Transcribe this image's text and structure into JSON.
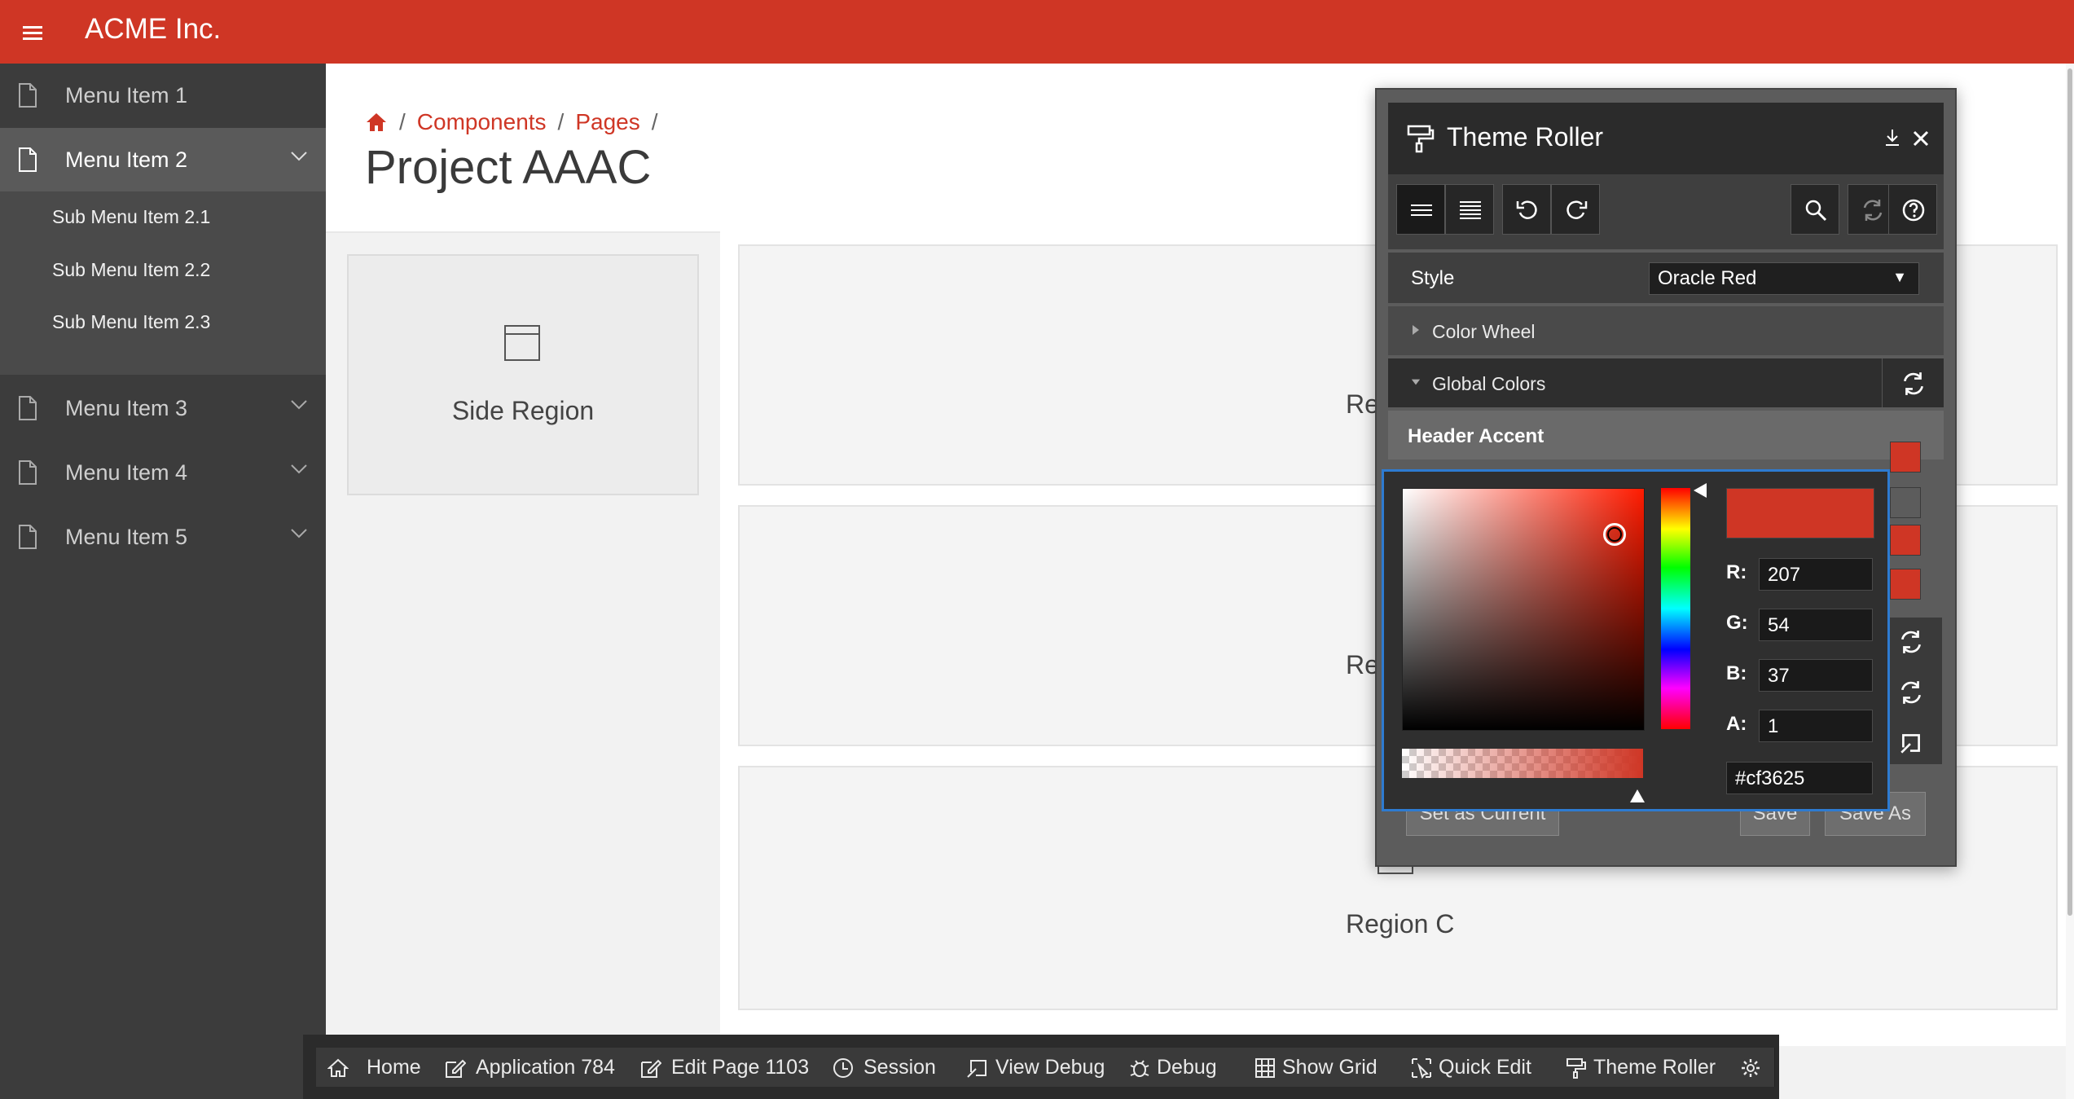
{
  "app": {
    "brand": "ACME Inc."
  },
  "colors": {
    "accent": "#cf3625",
    "sidebar": "#3c3c3c",
    "panel": "#2b2b2b"
  },
  "sidebar": {
    "items": [
      {
        "label": "Menu Item 1",
        "icon": "page-icon",
        "expanded": false,
        "has_children": false
      },
      {
        "label": "Menu Item 2",
        "icon": "page-icon",
        "expanded": true,
        "has_children": true,
        "children": [
          {
            "label": "Sub Menu Item 2.1"
          },
          {
            "label": "Sub Menu Item 2.2"
          },
          {
            "label": "Sub Menu Item 2.3"
          }
        ]
      },
      {
        "label": "Menu Item 3",
        "icon": "page-icon",
        "expanded": false,
        "has_children": true
      },
      {
        "label": "Menu Item 4",
        "icon": "page-icon",
        "expanded": false,
        "has_children": true
      },
      {
        "label": "Menu Item 5",
        "icon": "page-icon",
        "expanded": false,
        "has_children": true
      }
    ]
  },
  "breadcrumb": {
    "items": [
      "Components",
      "Pages"
    ],
    "separator": "/"
  },
  "page": {
    "title": "Project AAAC"
  },
  "regions": {
    "side": "Side Region",
    "a_partial": "Reg",
    "b_partial": "Re",
    "c": "Region C"
  },
  "theme_roller": {
    "title": "Theme Roller",
    "style_label": "Style",
    "style_value": "Oracle Red",
    "sections": {
      "color_wheel": "Color Wheel",
      "global_colors": "Global Colors"
    },
    "header_accent_label": "Header Accent",
    "swatches": [
      "#cf3625",
      "#5c5c5c",
      "#cf3625",
      "#cf3625"
    ],
    "buttons": {
      "set_current": "Set as Current",
      "save": "Save",
      "save_as": "Save As"
    }
  },
  "picker": {
    "labels": {
      "r": "R:",
      "g": "G:",
      "b": "B:",
      "a": "A:"
    },
    "r": "207",
    "g": "54",
    "b": "37",
    "a": "1",
    "hex": "#cf3625"
  },
  "dev_toolbar": {
    "items": [
      "Home",
      "Application 784",
      "Edit Page 1103",
      "Session",
      "View Debug",
      "Debug",
      "Show Grid",
      "Quick Edit",
      "Theme Roller"
    ]
  }
}
